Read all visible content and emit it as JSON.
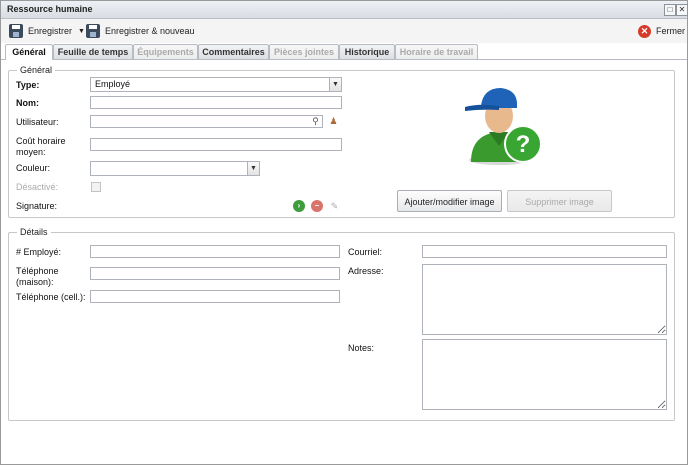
{
  "window": {
    "title": "Ressource humaine",
    "maximize_glyph": "□",
    "close_glyph": "✕"
  },
  "toolbar": {
    "save_label": "Enregistrer",
    "save_new_label": "Enregistrer & nouveau",
    "close_label": "Fermer",
    "save_icon": "floppy-disk-icon",
    "close_icon": "red-close-icon"
  },
  "tabs": [
    {
      "label": "Général",
      "state": "active"
    },
    {
      "label": "Feuille de temps",
      "state": "enabled"
    },
    {
      "label": "Équipements",
      "state": "disabled"
    },
    {
      "label": "Commentaires",
      "state": "enabled"
    },
    {
      "label": "Pièces jointes",
      "state": "disabled"
    },
    {
      "label": "Historique",
      "state": "enabled"
    },
    {
      "label": "Horaire de travail",
      "state": "disabled"
    }
  ],
  "general": {
    "legend": "Général",
    "type_label": "Type:",
    "type_value": "Employé",
    "nom_label": "Nom:",
    "nom_value": "",
    "utilisateur_label": "Utilisateur:",
    "utilisateur_value": "",
    "cout_label_1": "Coût horaire",
    "cout_label_2": "moyen:",
    "cout_value": "",
    "couleur_label": "Couleur:",
    "couleur_value": "",
    "desactive_label": "Désactivé:",
    "desactive_checked": false,
    "signature_label": "Signature:",
    "add_image_label": "Ajouter/modifier image",
    "delete_image_label": "Supprimer image"
  },
  "details": {
    "legend": "Détails",
    "employe_label": "# Employé:",
    "employe_value": "",
    "tel_maison_label_1": "Téléphone",
    "tel_maison_label_2": "(maison):",
    "tel_maison_value": "",
    "tel_cell_label": "Téléphone (cell.):",
    "tel_cell_value": "",
    "courriel_label": "Courriel:",
    "courriel_value": "",
    "adresse_label": "Adresse:",
    "adresse_value": "",
    "notes_label": "Notes:",
    "notes_value": ""
  },
  "colors": {
    "accent_blue": "#1e63b8",
    "help_green": "#39a532",
    "close_red": "#d43b2a"
  }
}
